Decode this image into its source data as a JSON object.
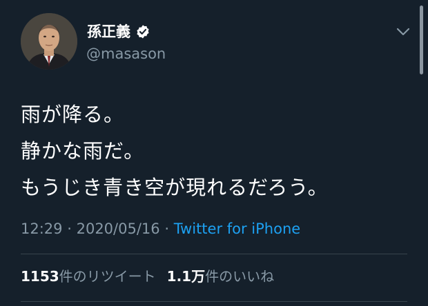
{
  "user": {
    "display_name": "孫正義",
    "handle": "@masason",
    "verified": true,
    "avatar_icon": "profile-photo"
  },
  "tweet": {
    "lines": [
      "雨が降る。",
      "静かな雨だ。",
      "もうじき青き空が現れるだろう。"
    ],
    "time": "12:29",
    "separator": "·",
    "date": "2020/05/16",
    "source": "Twitter for iPhone"
  },
  "stats": {
    "retweets_count": "1153",
    "retweets_label": "件のリツイート",
    "likes_count": "1.1万",
    "likes_label": "件のいいね"
  },
  "colors": {
    "background": "#15202b",
    "text": "#ffffff",
    "secondary": "#8899a6",
    "link": "#1da1f2",
    "divider": "#38444d"
  }
}
